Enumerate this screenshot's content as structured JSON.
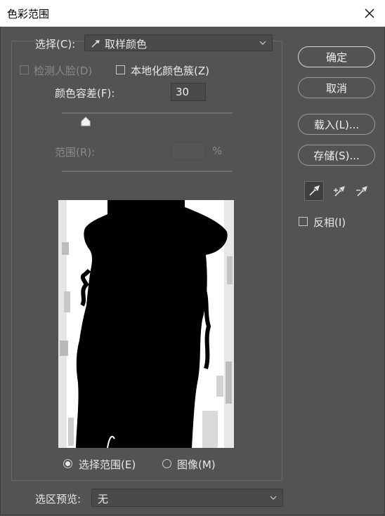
{
  "window": {
    "title": "色彩范围"
  },
  "select": {
    "label": "选择(C):",
    "value": "取样颜色"
  },
  "detect_faces": {
    "label": "检测人脸(D)",
    "checked": false,
    "disabled": true
  },
  "localized_clusters": {
    "label": "本地化颜色簇(Z)",
    "checked": false
  },
  "fuzziness": {
    "label": "颜色容差(F):",
    "value": "30"
  },
  "range": {
    "label": "范围(R):",
    "value": "",
    "unit": "%",
    "disabled": true
  },
  "buttons": {
    "ok": "确定",
    "cancel": "取消",
    "load": "载入(L)...",
    "save": "存储(S)..."
  },
  "eyedroppers": [
    "eyedropper-icon",
    "eyedropper-plus-icon",
    "eyedropper-minus-icon"
  ],
  "invert": {
    "label": "反相(I)",
    "checked": false
  },
  "view_mode": {
    "selection_label": "选择范围(E)",
    "image_label": "图像(M)",
    "selected": "selection"
  },
  "selection_preview": {
    "label": "选区预览:",
    "value": "无"
  },
  "colors": {
    "dialog_bg": "#535353",
    "titlebar_bg": "#ffffff",
    "preview_fg": "#000000",
    "preview_bg": "#ffffff"
  }
}
